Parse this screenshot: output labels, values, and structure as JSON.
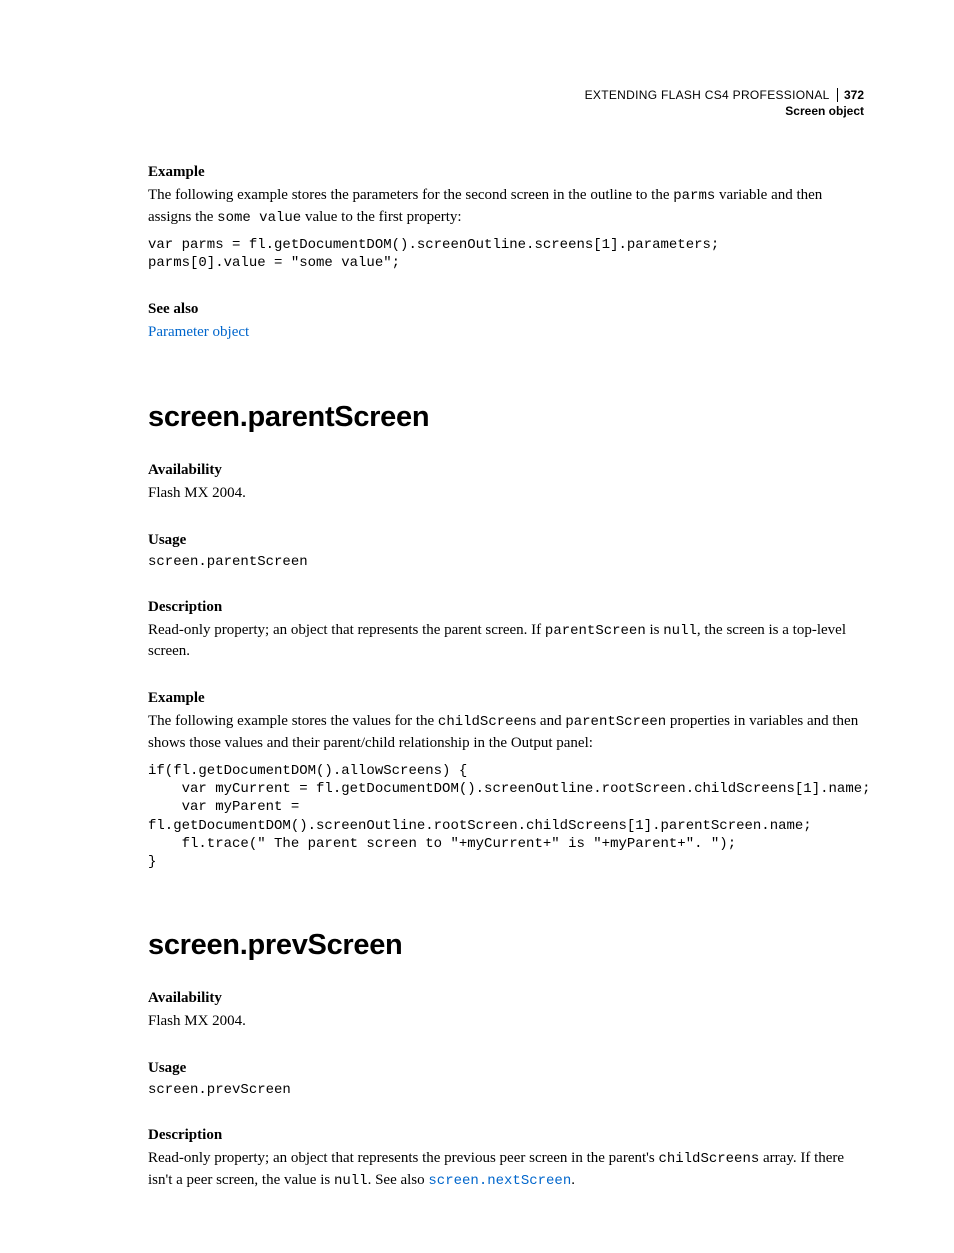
{
  "header": {
    "title": "EXTENDING FLASH CS4 PROFESSIONAL",
    "page": "372",
    "section": "Screen object"
  },
  "sec1": {
    "h_example": "Example",
    "p1a": "The following example stores the parameters for the second screen in the outline to the ",
    "p1_code1": "parms",
    "p1b": " variable and then assigns the ",
    "p1_code2": "some value",
    "p1c": " value to the first property:",
    "code": "var parms = fl.getDocumentDOM().screenOutline.screens[1].parameters;\nparms[0].value = \"some value\";",
    "h_seealso": "See also",
    "link1": "Parameter object"
  },
  "sec2": {
    "title": "screen.parentScreen",
    "h_avail": "Availability",
    "avail_text": "Flash MX 2004.",
    "h_usage": "Usage",
    "usage_code": "screen.parentScreen",
    "h_desc": "Description",
    "desc_a": "Read-only property; an object that represents the parent screen. If ",
    "desc_code1": "parentScreen",
    "desc_b": " is ",
    "desc_code2": "null",
    "desc_c": ", the screen is a top-level screen.",
    "h_example": "Example",
    "ex_a": "The following example stores the values for the ",
    "ex_code1": "childScreen",
    "ex_b": "s and ",
    "ex_code2": "parentScreen",
    "ex_c": " properties in variables and then shows those values and their parent/child relationship in the Output panel:",
    "code": "if(fl.getDocumentDOM().allowScreens) {\n    var myCurrent = fl.getDocumentDOM().screenOutline.rootScreen.childScreens[1].name;\n    var myParent =\nfl.getDocumentDOM().screenOutline.rootScreen.childScreens[1].parentScreen.name;\n    fl.trace(\" The parent screen to \"+myCurrent+\" is \"+myParent+\". \");\n}"
  },
  "sec3": {
    "title": "screen.prevScreen",
    "h_avail": "Availability",
    "avail_text": "Flash MX 2004.",
    "h_usage": "Usage",
    "usage_code": "screen.prevScreen",
    "h_desc": "Description",
    "desc_a": "Read-only property; an object that represents the previous peer screen in the parent's ",
    "desc_code1": "childScreens",
    "desc_b": " array. If there isn't a peer screen, the value is ",
    "desc_code2": "null",
    "desc_c": ". See also ",
    "link_code": "screen.nextScreen",
    "desc_d": "."
  }
}
